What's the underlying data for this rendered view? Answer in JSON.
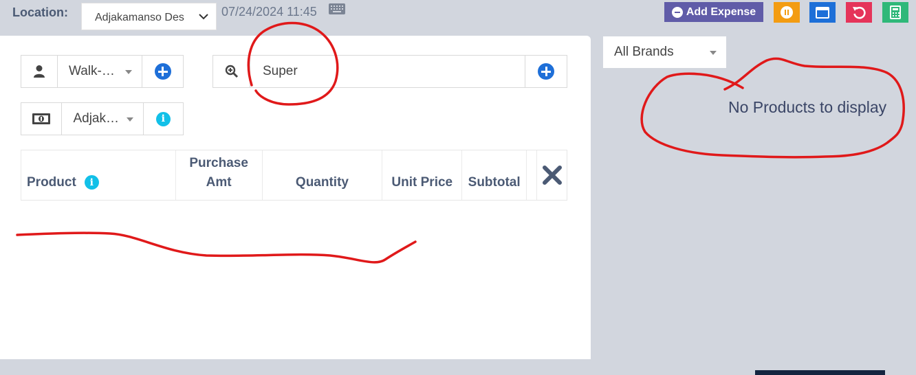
{
  "topbar": {
    "location_label": "Location:",
    "location_value": "Adjakamanso Des",
    "datetime": "07/24/2024 11:45",
    "add_expense_label": "Add Expense",
    "colors": {
      "expense": "#605ca8",
      "pause": "#f39c12",
      "window": "#1d6fd8",
      "undo": "#e5345a",
      "calculator": "#2fb879"
    }
  },
  "form": {
    "customer_value": "Walk-…",
    "account_value": "Adjak…",
    "search_value": "Super"
  },
  "table": {
    "headers": [
      "Product",
      "Purchase Amt",
      "Quantity",
      "Unit Price",
      "Subtotal"
    ]
  },
  "side": {
    "brand_filter": "All Brands",
    "empty_message": "No Products to display"
  },
  "icons": [
    "user-icon",
    "zoom-in-icon",
    "money-icon",
    "info-icon",
    "plus-circle-icon",
    "keyboard-icon",
    "close-icon",
    "pause-icon",
    "window-icon",
    "undo-icon",
    "calculator-icon"
  ]
}
